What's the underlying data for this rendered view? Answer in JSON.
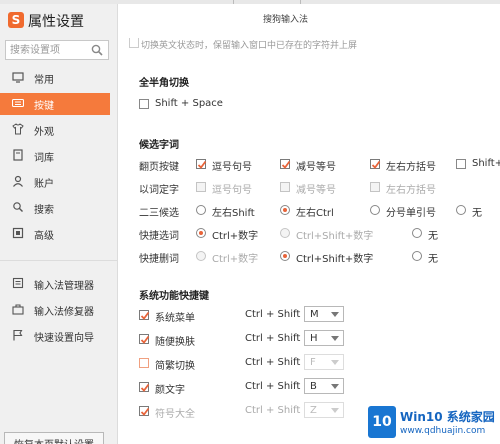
{
  "app": {
    "title": "属性设置",
    "logo_text": "S",
    "window_title": "搜狗输入法"
  },
  "search": {
    "placeholder": "搜索设置项"
  },
  "sidebar": {
    "items": [
      {
        "label": "常用",
        "icon": "monitor-icon"
      },
      {
        "label": "按键",
        "icon": "keyboard-icon",
        "active": true
      },
      {
        "label": "外观",
        "icon": "shirt-icon"
      },
      {
        "label": "词库",
        "icon": "book-icon"
      },
      {
        "label": "账户",
        "icon": "user-icon"
      },
      {
        "label": "搜索",
        "icon": "magnifier-icon"
      },
      {
        "label": "高级",
        "icon": "advanced-icon"
      }
    ],
    "tools": [
      {
        "label": "输入法管理器",
        "icon": "list-icon"
      },
      {
        "label": "输入法修复器",
        "icon": "toolbox-icon"
      },
      {
        "label": "快速设置向导",
        "icon": "flag-icon"
      }
    ],
    "restore_label": "恢复本页默认设置"
  },
  "main": {
    "cut_text": "切换英文状态时，保留输入窗口中已存在的字符并上屏",
    "fullhalf": {
      "title": "全半角切换",
      "option": "Shift + Space",
      "checked": false
    },
    "candidates": {
      "title": "候选字词",
      "rows": [
        {
          "label": "翻页按键",
          "options": [
            "逗号句号",
            "减号等号",
            "左右方括号",
            "Shift+"
          ]
        },
        {
          "label": "以词定字",
          "options": [
            "逗号句号",
            "减号等号",
            "左右方括号"
          ]
        },
        {
          "label": "二三候选",
          "options": [
            "左右Shift",
            "左右Ctrl",
            "分号单引号",
            "无"
          ]
        },
        {
          "label": "快捷选词",
          "options": [
            "Ctrl+数字",
            "Ctrl+Shift+数字",
            "无"
          ]
        },
        {
          "label": "快捷删词",
          "options": [
            "Ctrl+数字",
            "Ctrl+Shift+数字",
            "无"
          ]
        }
      ]
    },
    "shortcuts": {
      "title": "系统功能快捷键",
      "prefix": "Ctrl + Shift +",
      "items": [
        {
          "label": "系统菜单",
          "key": "M",
          "checked": true
        },
        {
          "label": "随便换肤",
          "key": "H",
          "checked": true
        },
        {
          "label": "简繁切换",
          "key": "F",
          "checked": false
        },
        {
          "label": "颜文字",
          "key": "B",
          "checked": true
        },
        {
          "label": "符号大全",
          "key": "Z",
          "checked": true
        }
      ]
    }
  },
  "watermark": {
    "logo": "10",
    "title": "Win10 系统家园",
    "url": "www.qdhuajin.com"
  },
  "colors": {
    "accent": "#f57a3c",
    "check": "#e8643a",
    "brand_blue": "#1565c0"
  }
}
